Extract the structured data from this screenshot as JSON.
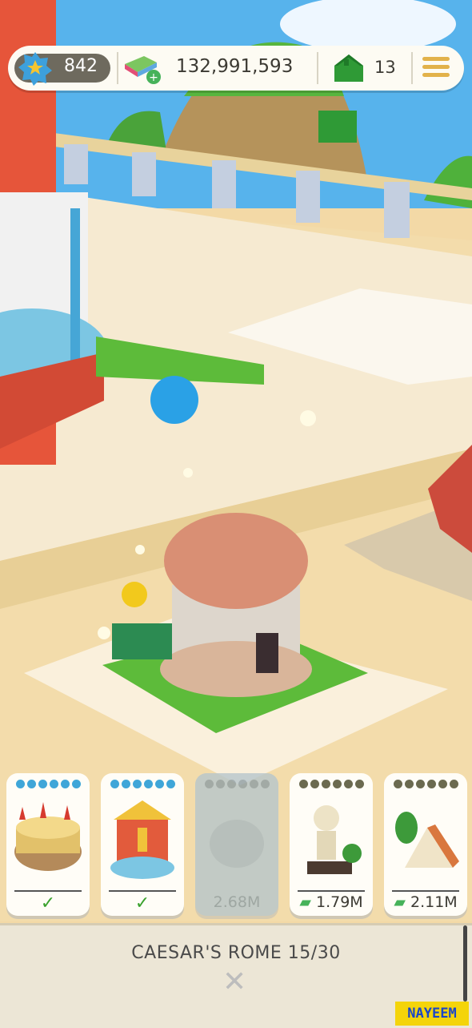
{
  "hud": {
    "xp_value": "842",
    "money_value": "132,991,593",
    "houses_value": "13",
    "icons": [
      "star-badge-icon",
      "money-stack-icon",
      "plus-icon",
      "green-house-icon",
      "menu-icon"
    ]
  },
  "colors": {
    "accent_green": "#3aa12d",
    "dot_blue": "#3fa6d8",
    "dot_olive": "#6b6a50",
    "money_green": "#46b25a",
    "badge_yellow": "#f4d40a"
  },
  "cards": [
    {
      "name": "colosseum",
      "status": "owned",
      "check": "✓",
      "price": ""
    },
    {
      "name": "fountain-temple",
      "status": "owned",
      "check": "✓",
      "price": ""
    },
    {
      "name": "locked-building",
      "status": "locked",
      "check": "",
      "price": "2.68M"
    },
    {
      "name": "statue",
      "status": "buy",
      "check": "",
      "price": "1.79M"
    },
    {
      "name": "tent",
      "status": "buy",
      "check": "",
      "price": "2.11M"
    }
  ],
  "bottom": {
    "level_text": "CAESAR'S ROME 15/30",
    "close_symbol": "✕"
  },
  "watermark": "NAYEEM"
}
